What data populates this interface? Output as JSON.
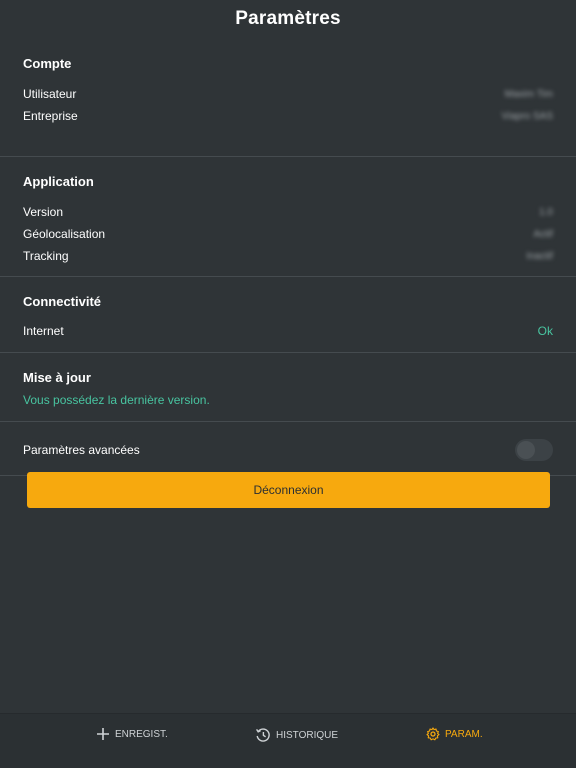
{
  "header": {
    "title": "Paramètres"
  },
  "account": {
    "title": "Compte",
    "rows": [
      {
        "label": "Utilisateur",
        "value": "Maxim Tim"
      },
      {
        "label": "Entreprise",
        "value": "Viapro SAS"
      }
    ]
  },
  "application": {
    "title": "Application",
    "rows": [
      {
        "label": "Version",
        "value": "1.0"
      },
      {
        "label": "Géolocalisation",
        "value": "Actif"
      },
      {
        "label": "Tracking",
        "value": "Inactif"
      }
    ]
  },
  "connectivity": {
    "title": "Connectivité",
    "rows": [
      {
        "label": "Internet",
        "value": "Ok"
      }
    ]
  },
  "update": {
    "title": "Mise à jour",
    "message": "Vous possédez la dernière version."
  },
  "advanced": {
    "label": "Paramètres avancées",
    "enabled": false
  },
  "logout": {
    "label": "Déconnexion"
  },
  "tabbar": {
    "items": [
      {
        "label": "ENREGIST.",
        "icon": "plus-icon",
        "active": false
      },
      {
        "label": "HISTORIQUE",
        "icon": "history-icon",
        "active": false
      },
      {
        "label": "PARAM.",
        "icon": "gear-icon",
        "active": true
      }
    ]
  },
  "colors": {
    "background": "#2f3437",
    "accent": "#f7a90e",
    "success": "#48c4a0"
  }
}
